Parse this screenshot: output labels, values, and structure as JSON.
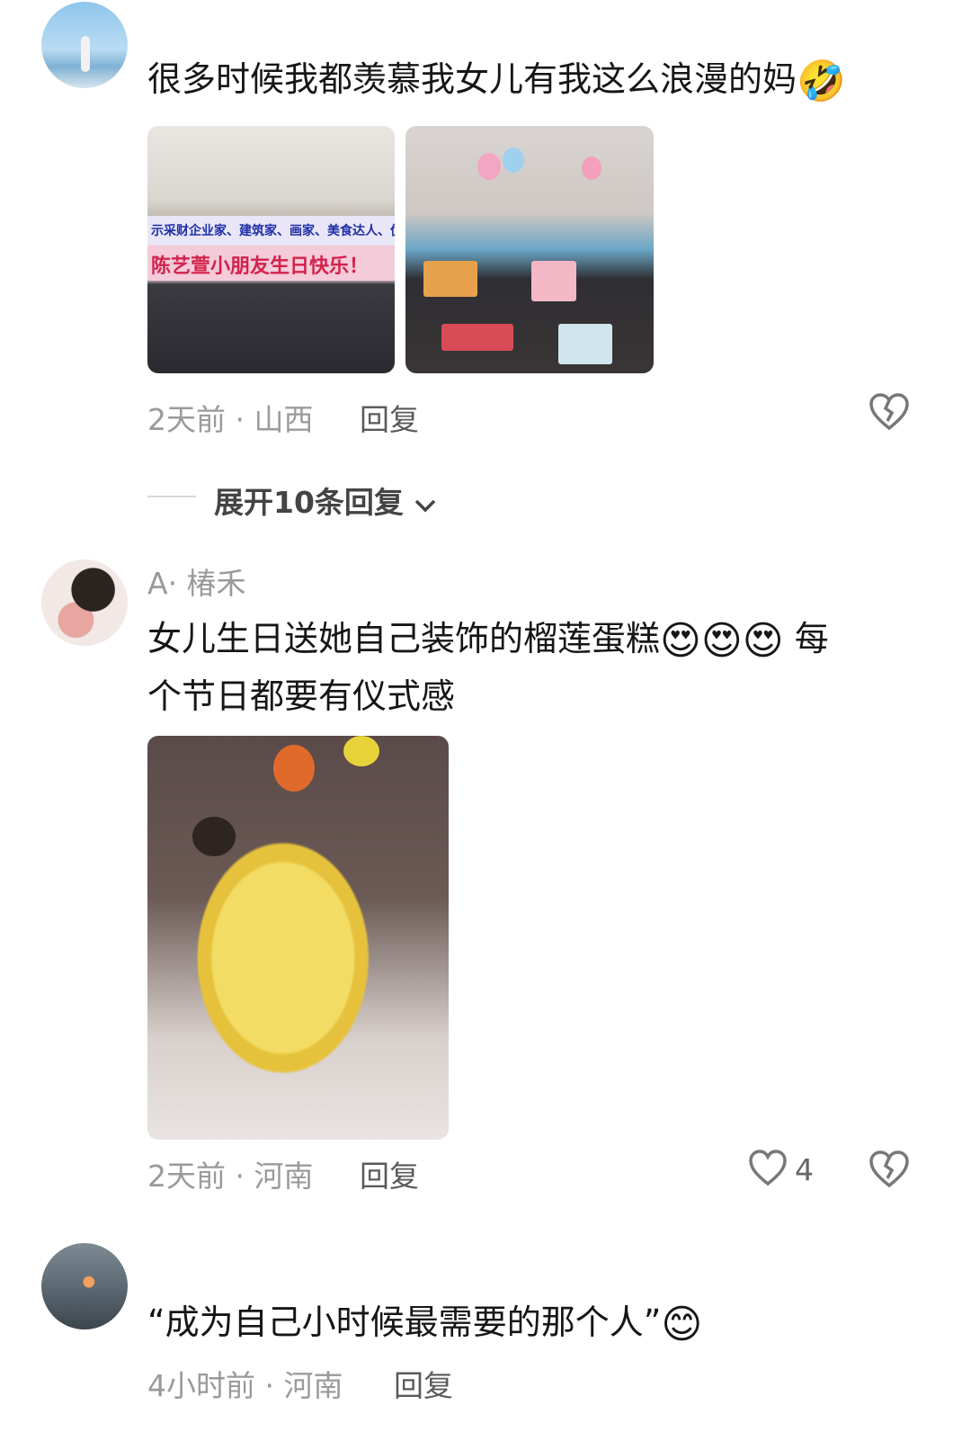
{
  "comments": [
    {
      "text": "很多时候我都羡慕我女儿有我这么浪漫的妈",
      "emoji": "🤣",
      "images": [
        {
          "alt_banner_top": "示采财企业家、建筑家、画家、美食达人、优秀的人民",
          "alt_banner_main": "陈艺萱小朋友生日快乐！"
        }
      ],
      "time_location": "2天前 · 山西",
      "reply_label": "回复",
      "expand_label": "展开10条回复"
    },
    {
      "author": "A· 椿禾",
      "text_line1": "女儿生日送她自己装饰的榴莲蛋糕",
      "emojis": "😍😍😍",
      "text_line1_tail": "每",
      "text_line2": "个节日都要有仪式感",
      "time_location": "2天前 · 河南",
      "reply_label": "回复",
      "like_count": "4"
    },
    {
      "text": "“成为自己小时候最需要的那个人”",
      "emoji": "😊",
      "time_location": "4小时前 · 河南",
      "reply_label": "回复"
    }
  ],
  "colors": {
    "meta": "#9a9a9a",
    "text": "#161616",
    "reply": "#5a5a5a",
    "divider": "#d8d8d8"
  }
}
